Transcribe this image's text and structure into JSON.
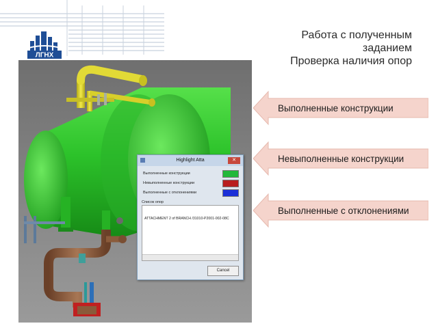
{
  "header": {
    "logo_text": "ЛГНХ",
    "title_lines": [
      "Работа с полученным",
      "заданием",
      "Проверка наличия опор"
    ]
  },
  "dialog": {
    "title": "Highlight Atta",
    "close_icon": "close-icon",
    "rows": [
      {
        "label": "Выполненные конструкции",
        "color": "#22b83a"
      },
      {
        "label": "Невыполненные конструкции",
        "color": "#b81e1e"
      },
      {
        "label": "Выполненные с отклонениями",
        "color": "#1a2fd8"
      }
    ],
    "list_label": "Список опор",
    "list_items": [
      "ATTACHMENT 2 of BRANCH /31010-P2001-002-08C"
    ],
    "cancel_label": "Cancel"
  },
  "arrows": [
    {
      "label": "Выполненные конструкции"
    },
    {
      "label": "Невыполненные конструкции"
    },
    {
      "label": "Выполненные с отклонениями"
    }
  ],
  "colors": {
    "arrow_fill": "#f5d4cc",
    "vessel_green": "#2fc42c",
    "pipe_yellow": "#d8cf2a",
    "pipe_brown": "#8a5a3a",
    "background_gray": "#7e7e7e",
    "logo_blue": "#1f4e96"
  }
}
